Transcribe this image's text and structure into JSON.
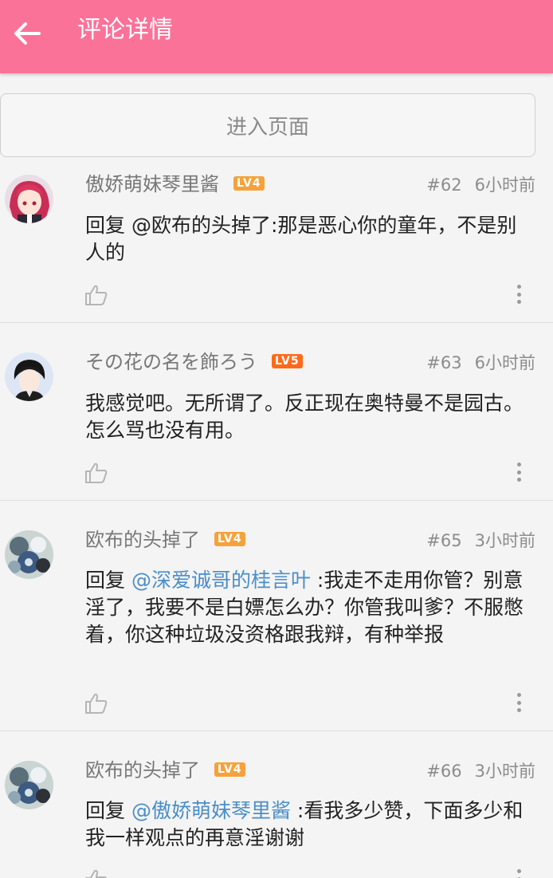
{
  "header": {
    "title": "评论详情"
  },
  "enter_page": {
    "label": "进入页面"
  },
  "colors": {
    "header_bg": "#fb7299",
    "mention": "#4b8ec8",
    "lv4": "#f5a23c",
    "lv5": "#ff6a1a"
  },
  "comments": [
    {
      "username": "傲娇萌妹琴里酱",
      "level": "LV4",
      "floor": "#62",
      "time": "6小时前",
      "reply_prefix": "回复 ",
      "mention": "@欧布的头掉了",
      "mention_highlight": false,
      "text": ":那是恶心你的童年，不是别人的"
    },
    {
      "username": "その花の名を飾ろう",
      "level": "LV5",
      "floor": "#63",
      "time": "6小时前",
      "reply_prefix": "",
      "mention": "",
      "mention_highlight": false,
      "text": "我感觉吧。无所谓了。反正现在奥特曼不是园古。怎么骂也没有用。"
    },
    {
      "username": "欧布的头掉了",
      "level": "LV4",
      "floor": "#65",
      "time": "3小时前",
      "reply_prefix": "回复 ",
      "mention": "@深爱诚哥的桂言叶",
      "mention_highlight": true,
      "text": " :我走不走用你管？别意淫了，我要不是白嫖怎么办？你管我叫爹？不服憋着，你这种垃圾没资格跟我辩，有种举报"
    },
    {
      "username": "欧布的头掉了",
      "level": "LV4",
      "floor": "#66",
      "time": "3小时前",
      "reply_prefix": "回复 ",
      "mention": "@傲娇萌妹琴里酱",
      "mention_highlight": true,
      "text": " :看我多少赞，下面多少和我一样观点的再意淫谢谢"
    }
  ]
}
